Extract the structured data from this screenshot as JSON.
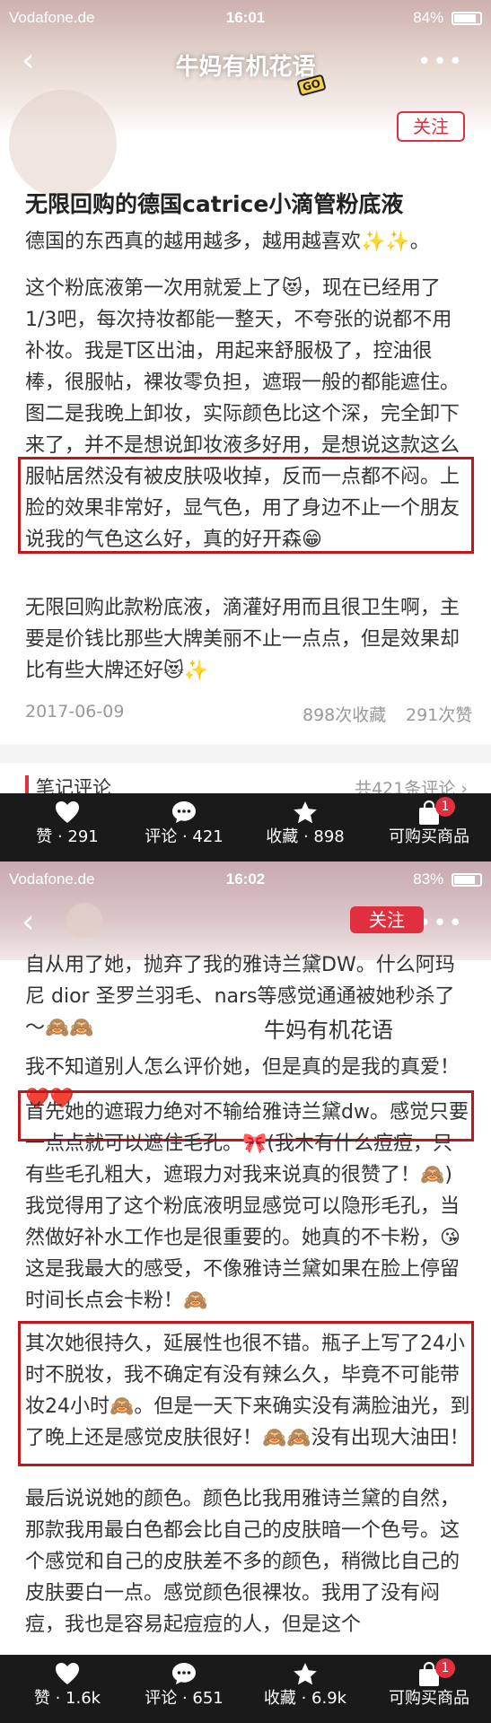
{
  "screen1": {
    "status": {
      "carrier": "Vodafone.de",
      "time": "16:01",
      "battery": "84%",
      "battery_level": 0.84
    },
    "nav": {
      "back": "‹",
      "title": "牛妈有机花语",
      "more": "•••",
      "go_badge": "GO"
    },
    "follow_label": "关注",
    "post_title": "无限回购的德国catrice小滴管粉底液",
    "para1": "德国的东西真的越用越多，越用越喜欢✨✨。",
    "para2": "这个粉底液第一次用就爱上了😻，现在已经用了1/3吧，每次持妆都能一整天，不夸张的说都不用补妆。我是T区出油，用起来舒服极了，控油很棒，很服帖，裸妆零负担，遮瑕一般的都能遮住。图二是我晚上卸妆，实际颜色比这个深，完全卸下来了，并不是想说卸妆液多好用，是想说这款这么服帖居然没有被皮肤吸收掉，反而一点都不闷。上脸的效果非常好，显气色，用了身边不止一个朋友说我的气色这么好，真的好开森😁",
    "para3": "无限回购此款粉底液，滴灌好用而且很卫生啊，主要是价钱比那些大牌美丽不止一点点，但是效果却比有些大牌还好😻✨",
    "date": "2017-06-09",
    "favorites": "898次收藏",
    "likes": "291次赞",
    "comments": {
      "label": "笔记评论",
      "count": "共421条评论 ›"
    },
    "bottom": {
      "like": "赞 · 291",
      "comment": "评论 · 421",
      "collect": "收藏 · 898",
      "buy": "可购买商品",
      "buy_badge": "1"
    }
  },
  "screen2": {
    "status": {
      "carrier": "Vodafone.de",
      "time": "16:02",
      "battery": "83%",
      "battery_level": 0.83
    },
    "nav": {
      "back": "‹",
      "more": "•••"
    },
    "follow_label": "关注",
    "watermark": "牛妈有机花语",
    "para1": "自从用了她，抛弃了我的雅诗兰黛DW。什么阿玛尼 dior 圣罗兰羽毛、nars等感觉通通被她秒杀了～🙈🙈",
    "para2": "我不知道别人怎么评价她，但是真的是我的真爱！❤️❤️",
    "para3": "首先她的遮瑕力绝对不输给雅诗兰黛dw。感觉只要一点点就可以遮住毛孔。🎀(我木有什么痘痘，只有些毛孔粗大，遮瑕力对我来说真的很赞了！🙈)我觉得用了这个粉底液明显感觉可以隐形毛孔，当然做好补水工作也是很重要的。她真的不卡粉，😘这是我最大的感受，不像雅诗兰黛如果在脸上停留时间长点会卡粉！🙈",
    "para4": "其次她很持久，延展性也很不错。瓶子上写了24小时不脱妆，我不确定有没有辣么久，毕竟不可能带妆24小时🙈。但是一天下来确实没有满脸油光，到了晚上还是感觉皮肤很好！🙈🙈没有出现大油田！",
    "para5": "最后说说她的颜色。颜色比我用雅诗兰黛的自然，那款我用最白色都会比自己的皮肤暗一个色号。这个感觉和自己的皮肤差不多的颜色，稍微比自己的皮肤要白一点。感觉颜色很裸妆。我用了没有闷痘，我也是容易起痘痘的人，但是这个",
    "bottom": {
      "like": "赞 · 1.6k",
      "comment": "评论 · 651",
      "collect": "收藏 · 6.9k",
      "buy": "可购买商品",
      "buy_badge": "1"
    }
  },
  "icons": {
    "like": "heart-icon",
    "comment": "chat-bubble-icon",
    "collect": "star-icon",
    "buy": "shopping-bag-icon"
  },
  "colors": {
    "accent": "#e0303f",
    "highlight_box": "#c0161d",
    "bottom_bar": "#1a1a1a"
  }
}
